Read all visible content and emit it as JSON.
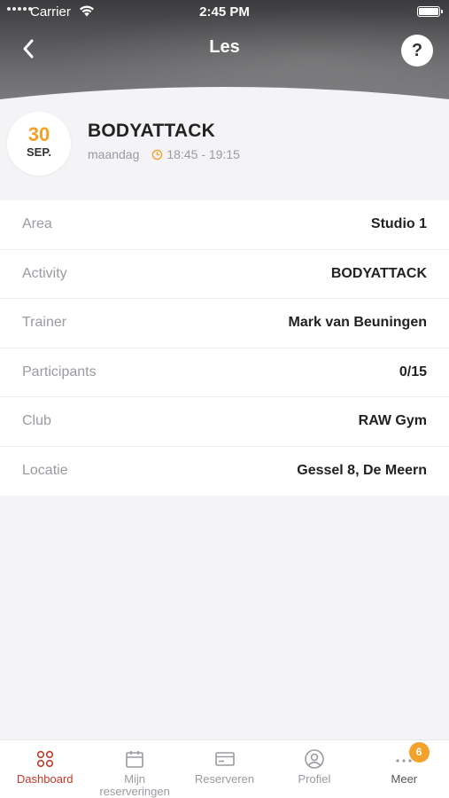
{
  "status_bar": {
    "carrier": "Carrier",
    "time": "2:45 PM"
  },
  "nav": {
    "title": "Les",
    "help_label": "?"
  },
  "class": {
    "day": "30",
    "month": "SEP.",
    "name": "BODYATTACK",
    "weekday": "maandag",
    "time": "18:45 - 19:15"
  },
  "details": [
    {
      "label": "Area",
      "value": "Studio 1"
    },
    {
      "label": "Activity",
      "value": "BODYATTACK"
    },
    {
      "label": "Trainer",
      "value": "Mark van Beuningen"
    },
    {
      "label": "Participants",
      "value": "0/15"
    },
    {
      "label": "Club",
      "value": "RAW Gym"
    },
    {
      "label": "Locatie",
      "value": "Gessel 8, De Meern"
    }
  ],
  "tabs": [
    {
      "label": "Dashboard",
      "icon": "dashboard-icon"
    },
    {
      "label": "Mijn reserveringen",
      "icon": "calendar-icon"
    },
    {
      "label": "Reserveren",
      "icon": "card-icon"
    },
    {
      "label": "Profiel",
      "icon": "profile-icon"
    },
    {
      "label": "Meer",
      "icon": "more-icon",
      "badge": "6"
    }
  ],
  "colors": {
    "accent": "#f2a22a",
    "active_tab": "#c0392b"
  }
}
